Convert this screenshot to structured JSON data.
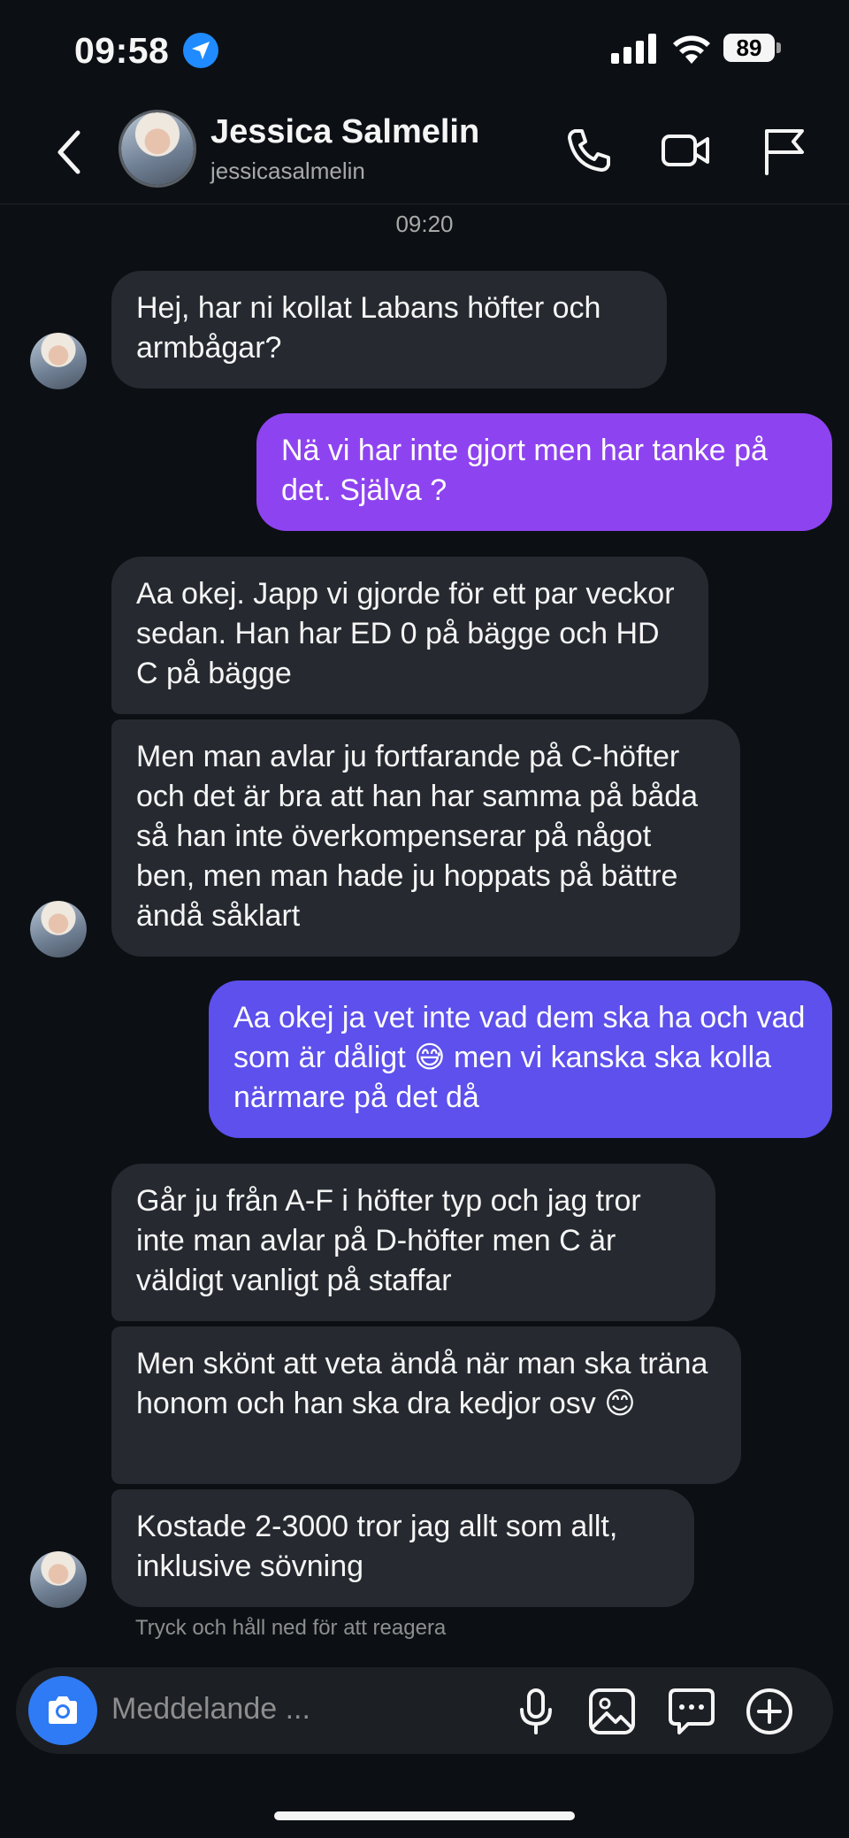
{
  "status_bar": {
    "time": "09:58",
    "battery": "89"
  },
  "header": {
    "name": "Jessica Salmelin",
    "handle": "jessicasalmelin"
  },
  "timestamp": "09:20",
  "messages": [
    {
      "from": "them",
      "text": "Hej, har ni kollat Labans höfter och armbågar?"
    },
    {
      "from": "me",
      "text": "Nä vi har inte gjort men har tanke på det. Själva ?"
    },
    {
      "from": "them",
      "text": "Aa okej. Japp vi gjorde för ett par veckor sedan. Han har ED 0 på bägge och HD C på bägge"
    },
    {
      "from": "them",
      "text": "Men man avlar ju fortfarande på C-höfter och det är bra att han har samma på båda så han inte överkompenserar på något ben, men man hade ju hoppats på bättre ändå såklart"
    },
    {
      "from": "me",
      "text_before": "Aa okej ja vet inte vad dem ska ha och vad som är dåligt ",
      "emoji": "😅",
      "text_after": " men vi kanska ska kolla närmare på det då"
    },
    {
      "from": "them",
      "text": "Går ju från A-F i höfter typ och jag tror inte man avlar på D-höfter men C är väldigt vanligt på staffar"
    },
    {
      "from": "them",
      "text": "Men skönt att veta ändå när man ska träna honom och han ska dra kedjor osv",
      "emoji": "😊"
    },
    {
      "from": "them",
      "text": "Kostade 2-3000 tror jag allt som allt, inklusive sövning"
    }
  ],
  "reaction_hint": "Tryck och håll ned för att reagera",
  "composer": {
    "placeholder": "Meddelande ..."
  },
  "colors": {
    "background": "#0c1014",
    "incoming_bubble": "#262a30",
    "outgoing_top": "#9b3ff0",
    "outgoing_bottom": "#5b52ee",
    "camera_button": "#2f7bf6"
  }
}
